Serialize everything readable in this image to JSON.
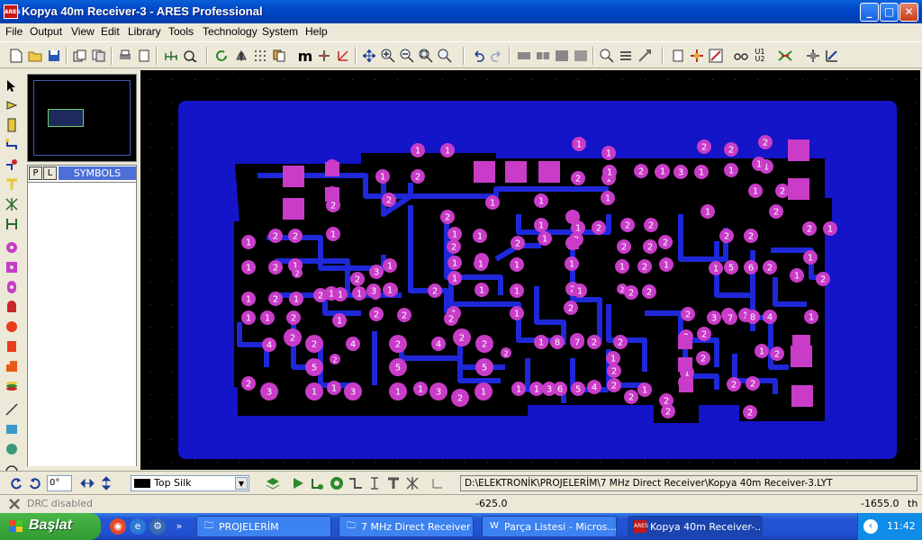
{
  "window": {
    "title": "Kopya 40m Receiver-3 - ARES Professional",
    "app_icon": "ARES",
    "buttons": {
      "minimize": "_",
      "maximize": "□",
      "close": "✕"
    }
  },
  "menu": [
    "File",
    "Output",
    "View",
    "Edit",
    "Library",
    "Tools",
    "Technology",
    "System",
    "Help"
  ],
  "selector": {
    "tab_p": "P",
    "tab_l": "L",
    "title": "SYMBOLS",
    "items": []
  },
  "controls": {
    "rotation": "0°",
    "layer": "Top Silk",
    "file_path": "D:\\ELEKTRONİK\\PROJELERİM\\7 MHz Direct Receiver\\Kopya 40m Receiver-3.LYT"
  },
  "status": {
    "drc": "DRC disabled",
    "x": "-625.0",
    "y": "-1655.0",
    "units": "th"
  },
  "taskbar": {
    "start": "Başlat",
    "tasks": [
      {
        "label": "PROJELERİM",
        "icon": "folder-icon",
        "active": false
      },
      {
        "label": "7 MHz Direct Receiver",
        "icon": "folder-icon",
        "active": false
      },
      {
        "label": "Parça Listesi - Micros...",
        "icon": "word-icon",
        "active": false
      },
      {
        "label": "Kopya 40m Receiver-...",
        "icon": "ares-icon",
        "active": true
      }
    ],
    "clock": "11:42"
  },
  "pcb": {
    "colors": {
      "board": "#1414c8",
      "copper": "#1e28d8",
      "pad": "#c83cc8",
      "text": "#ffffff",
      "bg": "#000000"
    },
    "pad_labels": [
      "1",
      "2",
      "3",
      "4",
      "5",
      "6",
      "7",
      "8"
    ]
  }
}
